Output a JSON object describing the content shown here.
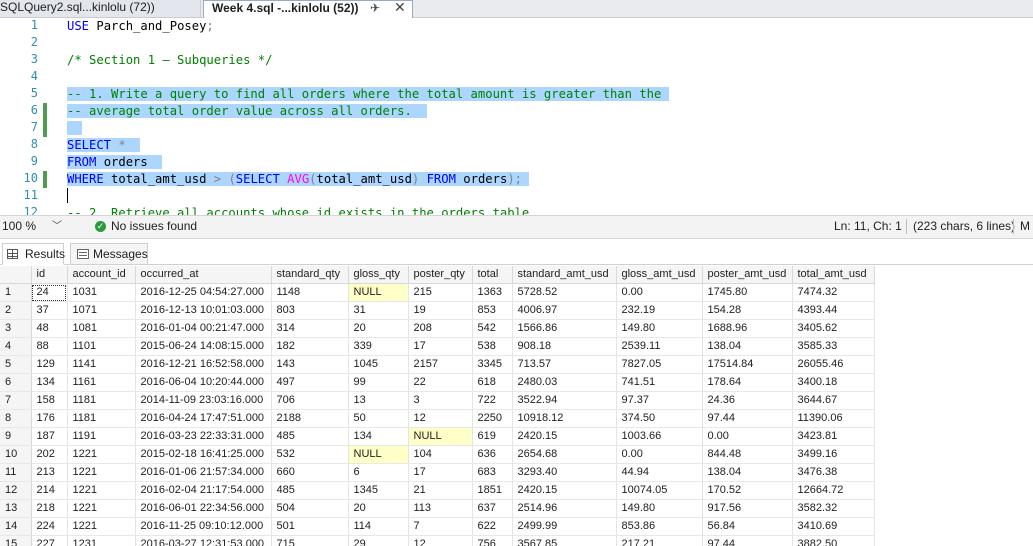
{
  "tabs": {
    "inactive": "SQLQuery2.sql...kinlolu (72))",
    "active": "Week 4.sql -...kinlolu (52))"
  },
  "editor": {
    "lines": [
      {
        "n": "1",
        "html": "<span class=\"kw\">USE</span> Parch_and_Posey<span class=\"gr\">;</span>"
      },
      {
        "n": "2",
        "html": ""
      },
      {
        "n": "3",
        "html": "<span class=\"cm\">/* Section 1 – Subqueries */</span>"
      },
      {
        "n": "4",
        "html": ""
      },
      {
        "n": "5",
        "html": "<span class=\"sel cm\">-- 1. Write a query to find all orders where the total amount is greater than the </span>"
      },
      {
        "n": "6",
        "html": "<span class=\"sel cm\">-- average total order value across all orders.  </span>"
      },
      {
        "n": "7",
        "html": "<span class=\"sel\">  </span>"
      },
      {
        "n": "8",
        "html": "<span class=\"sel\"><span class=\"kw\">SELECT</span> <span class=\"gr\">*</span>  </span>"
      },
      {
        "n": "9",
        "html": "<span class=\"sel\"><span class=\"kw\">FROM</span> orders  </span>"
      },
      {
        "n": "10",
        "html": "<span class=\"sel\"><span class=\"kw\">WHERE</span> total_amt_usd <span class=\"gr\">&gt;</span> <span class=\"gr\">(</span><span class=\"kw\">SELECT</span> <span class=\"fn\">AVG</span><span class=\"gr\">(</span>total_amt_usd<span class=\"gr\">)</span> <span class=\"kw\">FROM</span> orders<span class=\"gr\">);</span> </span>"
      },
      {
        "n": "11",
        "html": ""
      },
      {
        "n": "12",
        "html": "<span class=\"cm\">-- 2. Retrieve all accounts whose id exists in the orders table.</span>"
      }
    ]
  },
  "status": {
    "zoom": "100 %",
    "issues": "No issues found",
    "position": "Ln: 11, Ch: 1",
    "chars": "(223 chars, 6 lines)",
    "more": "M"
  },
  "results_tabs": {
    "results": "Results",
    "messages": "Messages"
  },
  "grid": {
    "columns": [
      "id",
      "account_id",
      "occurred_at",
      "standard_qty",
      "gloss_qty",
      "poster_qty",
      "total",
      "standard_amt_usd",
      "gloss_amt_usd",
      "poster_amt_usd",
      "total_amt_usd"
    ],
    "rows": [
      [
        "1",
        "24",
        "1031",
        "2016-12-25 04:54:27.000",
        "1148",
        "NULL",
        "215",
        "1363",
        "5728.52",
        "0.00",
        "1745.80",
        "7474.32"
      ],
      [
        "2",
        "37",
        "1071",
        "2016-12-13 10:01:03.000",
        "803",
        "31",
        "19",
        "853",
        "4006.97",
        "232.19",
        "154.28",
        "4393.44"
      ],
      [
        "3",
        "48",
        "1081",
        "2016-01-04 00:21:47.000",
        "314",
        "20",
        "208",
        "542",
        "1566.86",
        "149.80",
        "1688.96",
        "3405.62"
      ],
      [
        "4",
        "88",
        "1101",
        "2015-06-24 14:08:15.000",
        "182",
        "339",
        "17",
        "538",
        "908.18",
        "2539.11",
        "138.04",
        "3585.33"
      ],
      [
        "5",
        "129",
        "1141",
        "2016-12-21 16:52:58.000",
        "143",
        "1045",
        "2157",
        "3345",
        "713.57",
        "7827.05",
        "17514.84",
        "26055.46"
      ],
      [
        "6",
        "134",
        "1161",
        "2016-06-04 10:20:44.000",
        "497",
        "99",
        "22",
        "618",
        "2480.03",
        "741.51",
        "178.64",
        "3400.18"
      ],
      [
        "7",
        "158",
        "1181",
        "2014-11-09 23:03:16.000",
        "706",
        "13",
        "3",
        "722",
        "3522.94",
        "97.37",
        "24.36",
        "3644.67"
      ],
      [
        "8",
        "176",
        "1181",
        "2016-04-24 17:47:51.000",
        "2188",
        "50",
        "12",
        "2250",
        "10918.12",
        "374.50",
        "97.44",
        "11390.06"
      ],
      [
        "9",
        "187",
        "1191",
        "2016-03-23 22:33:31.000",
        "485",
        "134",
        "NULL",
        "619",
        "2420.15",
        "1003.66",
        "0.00",
        "3423.81"
      ],
      [
        "10",
        "202",
        "1221",
        "2015-02-18 16:41:25.000",
        "532",
        "NULL",
        "104",
        "636",
        "2654.68",
        "0.00",
        "844.48",
        "3499.16"
      ],
      [
        "11",
        "213",
        "1221",
        "2016-01-06 21:57:34.000",
        "660",
        "6",
        "17",
        "683",
        "3293.40",
        "44.94",
        "138.04",
        "3476.38"
      ],
      [
        "12",
        "214",
        "1221",
        "2016-02-04 21:17:54.000",
        "485",
        "1345",
        "21",
        "1851",
        "2420.15",
        "10074.05",
        "170.52",
        "12664.72"
      ],
      [
        "13",
        "218",
        "1221",
        "2016-06-01 22:34:56.000",
        "504",
        "20",
        "113",
        "637",
        "2514.96",
        "149.80",
        "917.56",
        "3582.32"
      ],
      [
        "14",
        "224",
        "1221",
        "2016-11-25 09:10:12.000",
        "501",
        "114",
        "7",
        "622",
        "2499.99",
        "853.86",
        "56.84",
        "3410.69"
      ],
      [
        "15",
        "227",
        "1231",
        "2016-03-27 12:31:53.000",
        "715",
        "29",
        "12",
        "756",
        "3567.85",
        "217.21",
        "97.44",
        "3882.50"
      ]
    ]
  }
}
